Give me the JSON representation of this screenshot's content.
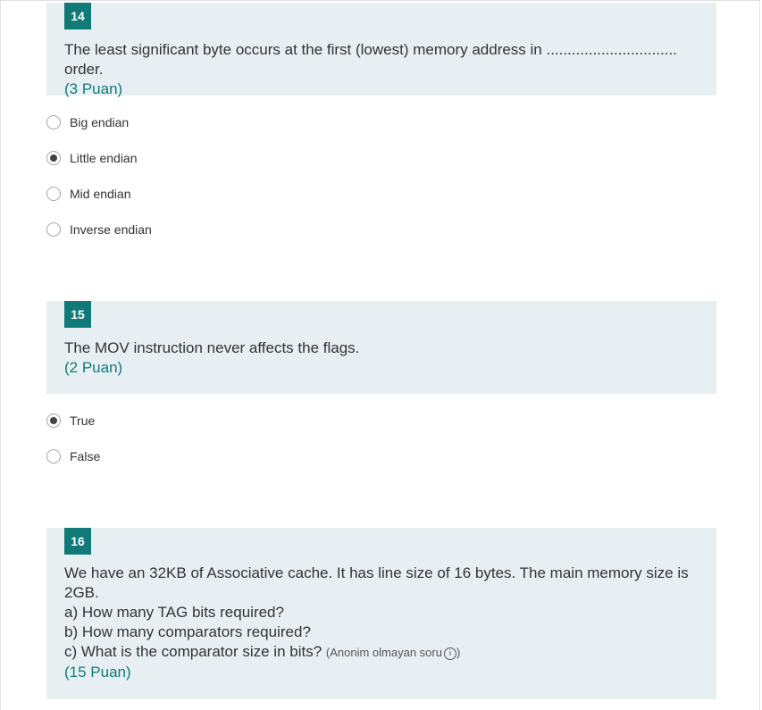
{
  "questions": [
    {
      "number": "14",
      "text": "The least significant byte occurs at the first (lowest) memory address in ............................... order.",
      "points": "(3 Puan)",
      "options": [
        {
          "label": "Big endian",
          "selected": false
        },
        {
          "label": "Little endian",
          "selected": true
        },
        {
          "label": "Mid endian",
          "selected": false
        },
        {
          "label": "Inverse endian",
          "selected": false
        }
      ]
    },
    {
      "number": "15",
      "text": "The MOV instruction never affects the flags.",
      "points": "(2 Puan)",
      "options": [
        {
          "label": "True",
          "selected": true
        },
        {
          "label": "False",
          "selected": false
        }
      ]
    },
    {
      "number": "16",
      "text": "We have an 32KB of Associative cache. It has line size of 16 bytes. The main memory size is 2GB.\na) How many TAG bits required?\nb) How many comparators required?\nc) What is the comparator size in bits?",
      "note": "(Anonim olmayan soru",
      "note_end": ")",
      "info_icon": "i",
      "points": "(15 Puan)"
    }
  ]
}
